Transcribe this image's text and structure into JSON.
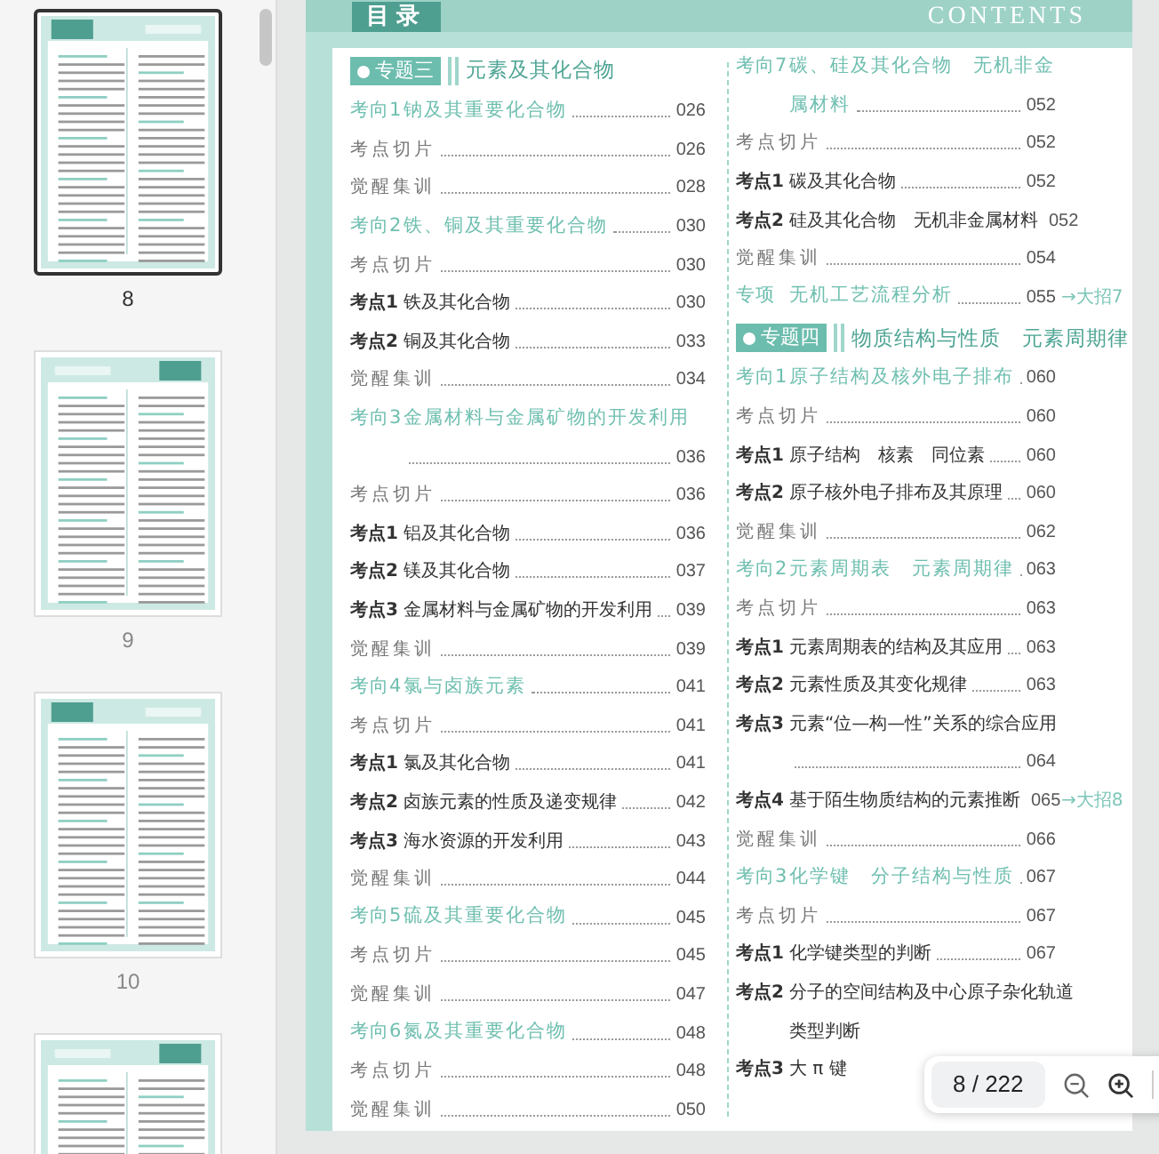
{
  "sidebar": {
    "thumbnails": [
      {
        "label": "8",
        "selected": true
      },
      {
        "label": "9",
        "selected": false
      },
      {
        "label": "10",
        "selected": false
      },
      {
        "selected": false
      }
    ]
  },
  "page": {
    "header": {
      "title": "目录",
      "subtitle": "CONTENTS"
    },
    "columns": [
      {
        "entries": [
          {
            "kind": "section",
            "badge": "专题三",
            "title": "元素及其化合物"
          },
          {
            "kind": "direction",
            "label": "考向1",
            "title": "钠及其重要化合物",
            "page": "026"
          },
          {
            "kind": "slice",
            "title": "考点切片",
            "page": "026"
          },
          {
            "kind": "practice",
            "title": "觉醒集训",
            "page": "028"
          },
          {
            "kind": "direction",
            "label": "考向2",
            "title": "铁、铜及其重要化合物",
            "page": "030"
          },
          {
            "kind": "slice",
            "title": "考点切片",
            "page": "030"
          },
          {
            "kind": "point",
            "label": "考点1",
            "title": "铁及其化合物",
            "page": "030"
          },
          {
            "kind": "point",
            "label": "考点2",
            "title": "铜及其化合物",
            "page": "033"
          },
          {
            "kind": "practice",
            "title": "觉醒集训",
            "page": "034"
          },
          {
            "kind": "direction",
            "label": "考向3",
            "title": "金属材料与金属矿物的开发利用",
            "page": "036",
            "wrap": true
          },
          {
            "kind": "slice",
            "title": "考点切片",
            "page": "036"
          },
          {
            "kind": "point",
            "label": "考点1",
            "title": "铝及其化合物",
            "page": "036"
          },
          {
            "kind": "point",
            "label": "考点2",
            "title": "镁及其化合物",
            "page": "037"
          },
          {
            "kind": "point",
            "label": "考点3",
            "title": "金属材料与金属矿物的开发利用",
            "page": "039"
          },
          {
            "kind": "practice",
            "title": "觉醒集训",
            "page": "039"
          },
          {
            "kind": "direction",
            "label": "考向4",
            "title": "氯与卤族元素",
            "page": "041"
          },
          {
            "kind": "slice",
            "title": "考点切片",
            "page": "041"
          },
          {
            "kind": "point",
            "label": "考点1",
            "title": "氯及其化合物",
            "page": "041"
          },
          {
            "kind": "point",
            "label": "考点2",
            "title": "卤族元素的性质及递变规律",
            "page": "042"
          },
          {
            "kind": "point",
            "label": "考点3",
            "title": "海水资源的开发利用",
            "page": "043"
          },
          {
            "kind": "practice",
            "title": "觉醒集训",
            "page": "044"
          },
          {
            "kind": "direction",
            "label": "考向5",
            "title": "硫及其重要化合物",
            "page": "045"
          },
          {
            "kind": "slice",
            "title": "考点切片",
            "page": "045"
          },
          {
            "kind": "practice",
            "title": "觉醒集训",
            "page": "047"
          },
          {
            "kind": "direction",
            "label": "考向6",
            "title": "氮及其重要化合物",
            "page": "048"
          },
          {
            "kind": "slice",
            "title": "考点切片",
            "page": "048"
          },
          {
            "kind": "practice",
            "title": "觉醒集训",
            "page": "050"
          }
        ]
      },
      {
        "entries": [
          {
            "kind": "direction",
            "label": "考向7",
            "title": "碳、硅及其化合物　无机非金",
            "continuation": "属材料",
            "page": "052"
          },
          {
            "kind": "slice",
            "title": "考点切片",
            "page": "052"
          },
          {
            "kind": "point",
            "label": "考点1",
            "title": "碳及其化合物",
            "page": "052"
          },
          {
            "kind": "point",
            "label": "考点2",
            "title": "硅及其化合物　无机非金属材料",
            "page": "052"
          },
          {
            "kind": "practice",
            "title": "觉醒集训",
            "page": "054"
          },
          {
            "kind": "special",
            "label": "专项",
            "title": "无机工艺流程分析",
            "page": "055",
            "note": "→大招7"
          },
          {
            "kind": "section",
            "badge": "专题四",
            "title": "物质结构与性质　元素周期律"
          },
          {
            "kind": "direction",
            "label": "考向1",
            "title": "原子结构及核外电子排布",
            "page": "060"
          },
          {
            "kind": "slice",
            "title": "考点切片",
            "page": "060"
          },
          {
            "kind": "point",
            "label": "考点1",
            "title": "原子结构　核素　同位素",
            "page": "060"
          },
          {
            "kind": "point",
            "label": "考点2",
            "title": "原子核外电子排布及其原理",
            "page": "060"
          },
          {
            "kind": "practice",
            "title": "觉醒集训",
            "page": "062"
          },
          {
            "kind": "direction",
            "label": "考向2",
            "title": "元素周期表　元素周期律",
            "page": "063"
          },
          {
            "kind": "slice",
            "title": "考点切片",
            "page": "063"
          },
          {
            "kind": "point",
            "label": "考点1",
            "title": "元素周期表的结构及其应用",
            "page": "063"
          },
          {
            "kind": "point",
            "label": "考点2",
            "title": "元素性质及其变化规律",
            "page": "063"
          },
          {
            "kind": "point",
            "label": "考点3",
            "title": "元素“位—构—性”关系的综合应用",
            "page": "064",
            "wrap": true
          },
          {
            "kind": "point",
            "label": "考点4",
            "title": "基于陌生物质结构的元素推断",
            "page": "065",
            "note": "→大招8"
          },
          {
            "kind": "practice",
            "title": "觉醒集训",
            "page": "066"
          },
          {
            "kind": "direction",
            "label": "考向3",
            "title": "化学键　分子结构与性质",
            "page": "067"
          },
          {
            "kind": "slice",
            "title": "考点切片",
            "page": "067"
          },
          {
            "kind": "point",
            "label": "考点1",
            "title": "化学键类型的判断",
            "page": "067"
          },
          {
            "kind": "point",
            "label": "考点2",
            "title": "分子的空间结构及中心原子杂化轨道",
            "continuation": "类型判断"
          },
          {
            "kind": "point",
            "label": "考点3",
            "title": "大 π 键"
          }
        ]
      }
    ]
  },
  "page_counter": {
    "text": "8 / 222"
  }
}
